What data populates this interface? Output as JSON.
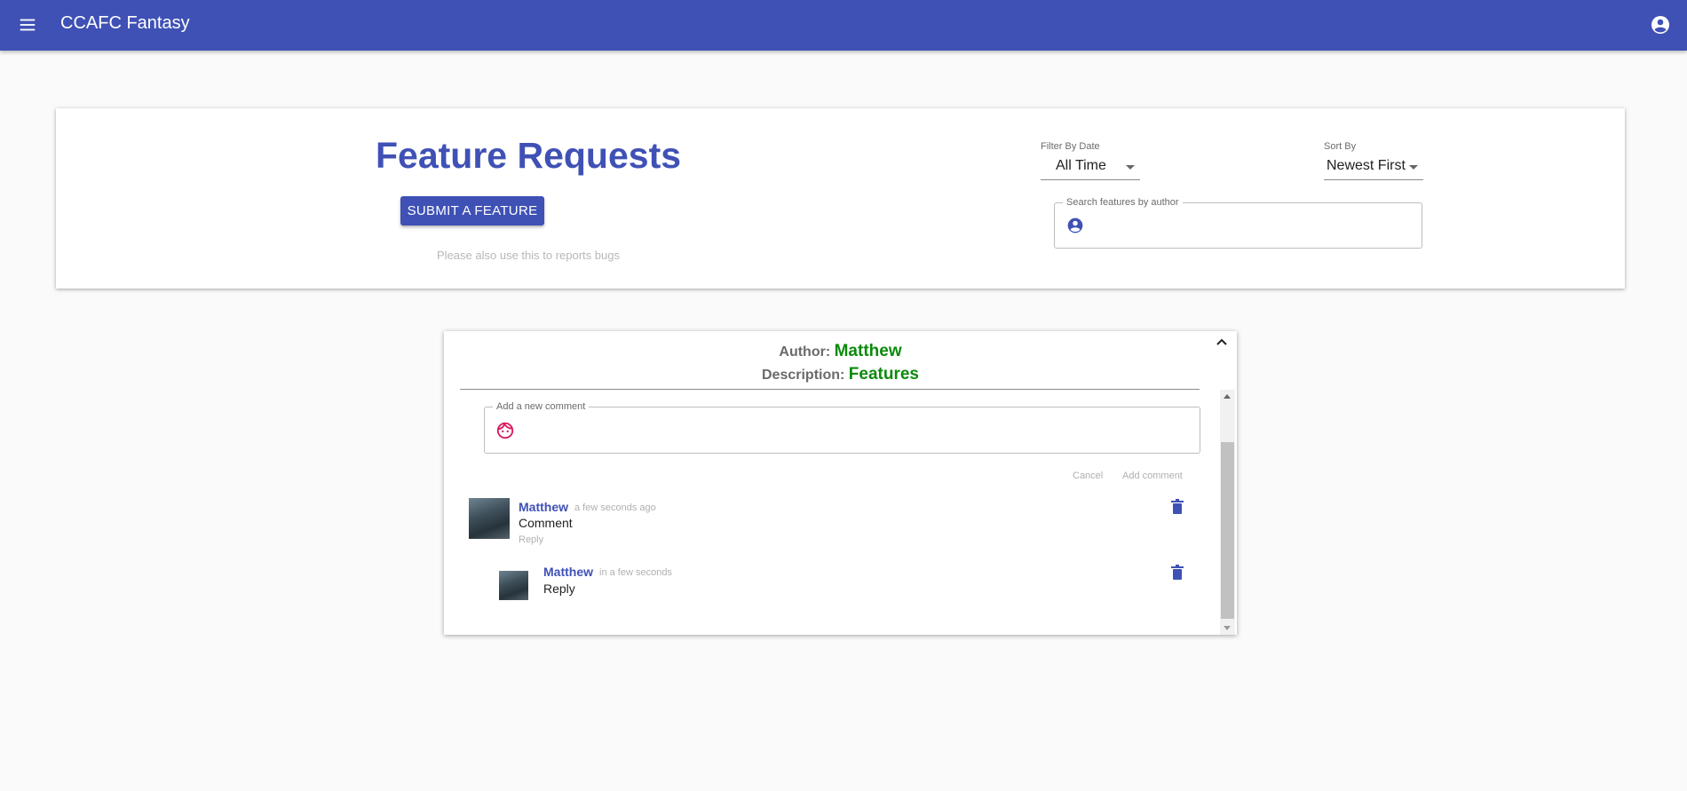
{
  "appbar": {
    "title": "CCAFC Fantasy",
    "menu_icon": "menu-icon",
    "account_icon": "account-circle-icon",
    "color": "#3f51b5"
  },
  "header": {
    "title": "Feature Requests",
    "submit_label": "SUBMIT A FEATURE",
    "hint": "Please also use this to reports bugs",
    "filter": {
      "label": "Filter By Date",
      "value": "All Time"
    },
    "sort": {
      "label": "Sort By",
      "value": "Newest First"
    },
    "search": {
      "label": "Search features by author",
      "icon": "account-circle-icon"
    }
  },
  "feature": {
    "author_label": "Author:",
    "author": "Matthew",
    "description_label": "Description:",
    "description": "Features",
    "new_comment": {
      "label": "Add a new comment",
      "icon": "face-icon"
    },
    "cancel_label": "Cancel",
    "add_comment_label": "Add comment",
    "comments": [
      {
        "author": "Matthew",
        "time": "a few seconds ago",
        "text": "Comment",
        "reply_label": "Reply",
        "replies": [
          {
            "author": "Matthew",
            "time": "in a few seconds",
            "text": "Reply"
          }
        ]
      }
    ]
  },
  "colors": {
    "primary": "#3f51b5",
    "accent_green": "#0b8a0b",
    "face_icon": "#d81b60"
  }
}
